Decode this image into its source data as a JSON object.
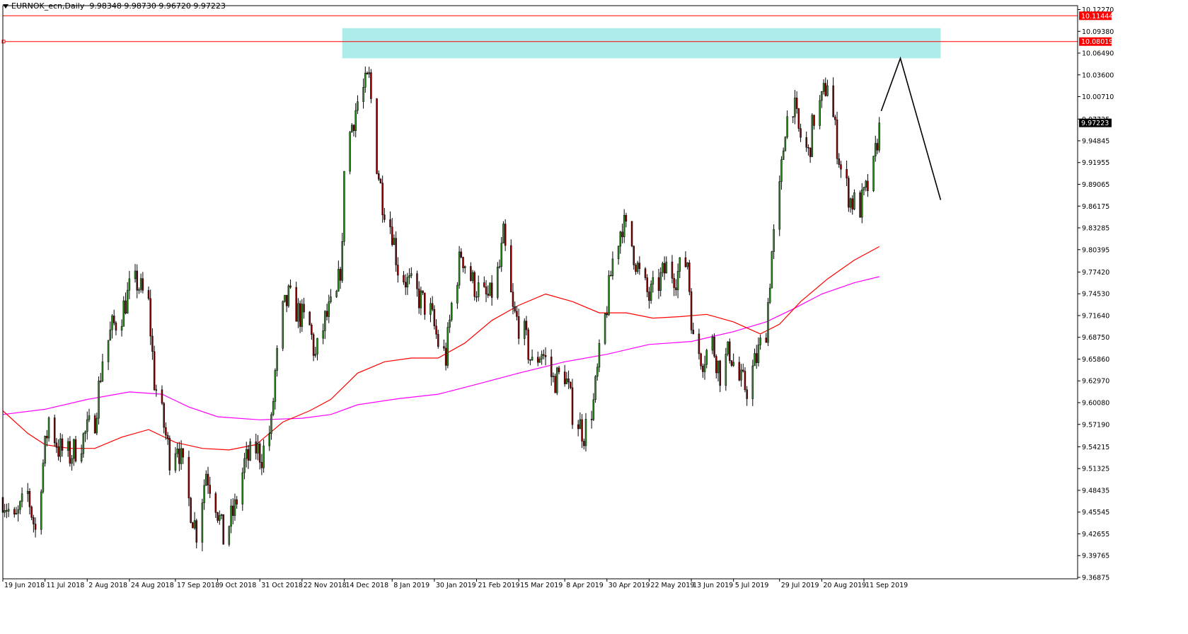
{
  "header": {
    "symbol": "EURNOK_ecn,Daily",
    "ohlc": "9.98348 9.98730 9.96720 9.97223"
  },
  "colors": {
    "bull": "#2e8b22",
    "bear": "#8b0000",
    "ma_fast": "#ff0000",
    "ma_slow": "#ff00ff",
    "zone": "#aeeceb",
    "hline": "#ff0000",
    "projection": "#000000"
  },
  "chart_data": {
    "type": "candlestick",
    "title": "",
    "ylim": [
      9.36875,
      10.1227
    ],
    "y_ticks": [
      {
        "value": 10.1227,
        "label": "10.12270"
      },
      {
        "value": 10.0938,
        "label": "10.09380"
      },
      {
        "value": 10.0649,
        "label": "10.06490"
      },
      {
        "value": 10.036,
        "label": "10.03600"
      },
      {
        "value": 10.0071,
        "label": "10.00710"
      },
      {
        "value": 9.97725,
        "label": "9.97725"
      },
      {
        "value": 9.94845,
        "label": "9.94845"
      },
      {
        "value": 9.91955,
        "label": "9.91955"
      },
      {
        "value": 9.89065,
        "label": "9.89065"
      },
      {
        "value": 9.86175,
        "label": "9.86175"
      },
      {
        "value": 9.83285,
        "label": "9.83285"
      },
      {
        "value": 9.80395,
        "label": "9.80395"
      },
      {
        "value": 9.7742,
        "label": "9.77420"
      },
      {
        "value": 9.7453,
        "label": "9.74530"
      },
      {
        "value": 9.7164,
        "label": "9.71640"
      },
      {
        "value": 9.6875,
        "label": "9.68750"
      },
      {
        "value": 9.6586,
        "label": "9.65860"
      },
      {
        "value": 9.6297,
        "label": "9.62970"
      },
      {
        "value": 9.6008,
        "label": "9.60080"
      },
      {
        "value": 9.5719,
        "label": "9.57190"
      },
      {
        "value": 9.54215,
        "label": "9.54215"
      },
      {
        "value": 9.51325,
        "label": "9.51325"
      },
      {
        "value": 9.48435,
        "label": "9.48435"
      },
      {
        "value": 9.45545,
        "label": "9.45545"
      },
      {
        "value": 9.42655,
        "label": "9.42655"
      },
      {
        "value": 9.39765,
        "label": "9.39765"
      },
      {
        "value": 9.36875,
        "label": "9.36875"
      }
    ],
    "price_tags": [
      {
        "value": 10.11444,
        "label": "10.11444",
        "kind": "line"
      },
      {
        "value": 10.08019,
        "label": "10.08019",
        "kind": "line"
      },
      {
        "value": 9.97223,
        "label": "9.97223",
        "kind": "current"
      }
    ],
    "x_labels": [
      {
        "date": "2018-06-19",
        "label": "19 Jun 2018"
      },
      {
        "date": "2018-07-11",
        "label": "11 Jul 2018"
      },
      {
        "date": "2018-08-02",
        "label": "2 Aug 2018"
      },
      {
        "date": "2018-08-24",
        "label": "24 Aug 2018"
      },
      {
        "date": "2018-09-17",
        "label": "17 Sep 2018"
      },
      {
        "date": "2018-10-09",
        "label": "9 Oct 2018"
      },
      {
        "date": "2018-10-31",
        "label": "31 Oct 2018"
      },
      {
        "date": "2018-11-22",
        "label": "22 Nov 2018"
      },
      {
        "date": "2018-12-14",
        "label": "14 Dec 2018"
      },
      {
        "date": "2019-01-08",
        "label": "8 Jan 2019"
      },
      {
        "date": "2019-01-30",
        "label": "30 Jan 2019"
      },
      {
        "date": "2019-02-21",
        "label": "21 Feb 2019"
      },
      {
        "date": "2019-03-15",
        "label": "15 Mar 2019"
      },
      {
        "date": "2019-04-08",
        "label": "8 Apr 2019"
      },
      {
        "date": "2019-04-30",
        "label": "30 Apr 2019"
      },
      {
        "date": "2019-05-22",
        "label": "22 May 2019"
      },
      {
        "date": "2019-06-13",
        "label": "13 Jun 2019"
      },
      {
        "date": "2019-07-05",
        "label": "5 Jul 2019"
      },
      {
        "date": "2019-07-29",
        "label": "29 Jul 2019"
      },
      {
        "date": "2019-08-20",
        "label": "20 Aug 2019"
      },
      {
        "date": "2019-09-11",
        "label": "11 Sep 2019"
      }
    ],
    "close_path": [
      [
        "2018-06-19",
        9.475
      ],
      [
        "2018-06-25",
        9.44
      ],
      [
        "2018-07-02",
        9.48
      ],
      [
        "2018-07-06",
        9.43
      ],
      [
        "2018-07-09",
        9.5
      ],
      [
        "2018-07-13",
        9.58
      ],
      [
        "2018-07-18",
        9.54
      ],
      [
        "2018-07-24",
        9.53
      ],
      [
        "2018-07-30",
        9.55
      ],
      [
        "2018-08-06",
        9.58
      ],
      [
        "2018-08-10",
        9.66
      ],
      [
        "2018-08-15",
        9.7
      ],
      [
        "2018-08-20",
        9.72
      ],
      [
        "2018-08-24",
        9.75
      ],
      [
        "2018-08-28",
        9.76
      ],
      [
        "2018-09-03",
        9.73
      ],
      [
        "2018-09-06",
        9.63
      ],
      [
        "2018-09-11",
        9.57
      ],
      [
        "2018-09-14",
        9.53
      ],
      [
        "2018-09-18",
        9.55
      ],
      [
        "2018-09-24",
        9.47
      ],
      [
        "2018-09-28",
        9.43
      ],
      [
        "2018-10-03",
        9.51
      ],
      [
        "2018-10-08",
        9.47
      ],
      [
        "2018-10-12",
        9.42
      ],
      [
        "2018-10-18",
        9.46
      ],
      [
        "2018-10-23",
        9.52
      ],
      [
        "2018-10-29",
        9.54
      ],
      [
        "2018-11-01",
        9.53
      ],
      [
        "2018-11-06",
        9.57
      ],
      [
        "2018-11-08",
        9.64
      ],
      [
        "2018-11-12",
        9.72
      ],
      [
        "2018-11-15",
        9.74
      ],
      [
        "2018-11-20",
        9.72
      ],
      [
        "2018-11-26",
        9.7
      ],
      [
        "2018-11-29",
        9.66
      ],
      [
        "2018-12-04",
        9.71
      ],
      [
        "2018-12-10",
        9.74
      ],
      [
        "2018-12-13",
        9.8
      ],
      [
        "2018-12-14",
        9.92
      ],
      [
        "2018-12-18",
        9.97
      ],
      [
        "2018-12-21",
        10.0
      ],
      [
        "2018-12-27",
        10.03
      ],
      [
        "2018-12-31",
        9.92
      ],
      [
        "2019-01-03",
        9.87
      ],
      [
        "2019-01-08",
        9.83
      ],
      [
        "2019-01-11",
        9.78
      ],
      [
        "2019-01-16",
        9.76
      ],
      [
        "2019-01-22",
        9.74
      ],
      [
        "2019-01-28",
        9.72
      ],
      [
        "2019-02-01",
        9.68
      ],
      [
        "2019-02-05",
        9.66
      ],
      [
        "2019-02-08",
        9.73
      ],
      [
        "2019-02-13",
        9.8
      ],
      [
        "2019-02-19",
        9.76
      ],
      [
        "2019-02-25",
        9.74
      ],
      [
        "2019-02-28",
        9.74
      ],
      [
        "2019-03-05",
        9.78
      ],
      [
        "2019-03-07",
        9.82
      ],
      [
        "2019-03-12",
        9.72
      ],
      [
        "2019-03-18",
        9.69
      ],
      [
        "2019-03-22",
        9.65
      ],
      [
        "2019-03-27",
        9.67
      ],
      [
        "2019-04-02",
        9.63
      ],
      [
        "2019-04-08",
        9.64
      ],
      [
        "2019-04-12",
        9.59
      ],
      [
        "2019-04-18",
        9.56
      ],
      [
        "2019-04-23",
        9.6
      ],
      [
        "2019-04-26",
        9.66
      ],
      [
        "2019-04-30",
        9.73
      ],
      [
        "2019-05-03",
        9.79
      ],
      [
        "2019-05-08",
        9.84
      ],
      [
        "2019-05-13",
        9.81
      ],
      [
        "2019-05-17",
        9.77
      ],
      [
        "2019-05-22",
        9.74
      ],
      [
        "2019-05-27",
        9.76
      ],
      [
        "2019-05-31",
        9.78
      ],
      [
        "2019-06-05",
        9.77
      ],
      [
        "2019-06-11",
        9.79
      ],
      [
        "2019-06-14",
        9.68
      ],
      [
        "2019-06-19",
        9.66
      ],
      [
        "2019-06-24",
        9.68
      ],
      [
        "2019-06-28",
        9.64
      ],
      [
        "2019-07-03",
        9.67
      ],
      [
        "2019-07-08",
        9.63
      ],
      [
        "2019-07-12",
        9.62
      ],
      [
        "2019-07-17",
        9.66
      ],
      [
        "2019-07-22",
        9.7
      ],
      [
        "2019-07-25",
        9.8
      ],
      [
        "2019-07-29",
        9.88
      ],
      [
        "2019-08-01",
        9.97
      ],
      [
        "2019-08-05",
        10.0
      ],
      [
        "2019-08-08",
        9.96
      ],
      [
        "2019-08-13",
        9.93
      ],
      [
        "2019-08-16",
        9.98
      ],
      [
        "2019-08-20",
        10.0
      ],
      [
        "2019-08-23",
        10.03
      ],
      [
        "2019-08-27",
        9.96
      ],
      [
        "2019-08-30",
        9.91
      ],
      [
        "2019-09-04",
        9.87
      ],
      [
        "2019-09-09",
        9.86
      ],
      [
        "2019-09-12",
        9.88
      ],
      [
        "2019-09-16",
        9.91
      ],
      [
        "2019-09-19",
        9.97223
      ]
    ],
    "ma_fast": [
      [
        "2018-06-19",
        9.59
      ],
      [
        "2018-07-02",
        9.56
      ],
      [
        "2018-07-11",
        9.545
      ],
      [
        "2018-07-24",
        9.54
      ],
      [
        "2018-08-06",
        9.54
      ],
      [
        "2018-08-20",
        9.555
      ],
      [
        "2018-09-03",
        9.565
      ],
      [
        "2018-09-17",
        9.548
      ],
      [
        "2018-10-01",
        9.54
      ],
      [
        "2018-10-15",
        9.538
      ],
      [
        "2018-10-29",
        9.545
      ],
      [
        "2018-11-12",
        9.575
      ],
      [
        "2018-11-26",
        9.59
      ],
      [
        "2018-12-07",
        9.605
      ],
      [
        "2018-12-21",
        9.64
      ],
      [
        "2019-01-04",
        9.655
      ],
      [
        "2019-01-18",
        9.66
      ],
      [
        "2019-02-01",
        9.66
      ],
      [
        "2019-02-15",
        9.68
      ],
      [
        "2019-03-01",
        9.71
      ],
      [
        "2019-03-15",
        9.73
      ],
      [
        "2019-03-29",
        9.745
      ],
      [
        "2019-04-12",
        9.735
      ],
      [
        "2019-04-26",
        9.72
      ],
      [
        "2019-05-10",
        9.72
      ],
      [
        "2019-05-24",
        9.713
      ],
      [
        "2019-06-07",
        9.715
      ],
      [
        "2019-06-21",
        9.718
      ],
      [
        "2019-07-05",
        9.708
      ],
      [
        "2019-07-19",
        9.692
      ],
      [
        "2019-07-29",
        9.705
      ],
      [
        "2019-08-09",
        9.735
      ],
      [
        "2019-08-23",
        9.765
      ],
      [
        "2019-09-06",
        9.79
      ],
      [
        "2019-09-19",
        9.808
      ]
    ],
    "ma_slow": [
      [
        "2018-06-19",
        9.585
      ],
      [
        "2018-07-11",
        9.592
      ],
      [
        "2018-08-02",
        9.605
      ],
      [
        "2018-08-24",
        9.615
      ],
      [
        "2018-09-10",
        9.612
      ],
      [
        "2018-09-24",
        9.595
      ],
      [
        "2018-10-09",
        9.582
      ],
      [
        "2018-10-31",
        9.578
      ],
      [
        "2018-11-22",
        9.58
      ],
      [
        "2018-12-07",
        9.585
      ],
      [
        "2018-12-21",
        9.598
      ],
      [
        "2019-01-11",
        9.606
      ],
      [
        "2019-02-01",
        9.612
      ],
      [
        "2019-02-21",
        9.625
      ],
      [
        "2019-03-15",
        9.64
      ],
      [
        "2019-04-08",
        9.655
      ],
      [
        "2019-04-30",
        9.665
      ],
      [
        "2019-05-22",
        9.678
      ],
      [
        "2019-06-13",
        9.682
      ],
      [
        "2019-07-05",
        9.695
      ],
      [
        "2019-07-22",
        9.708
      ],
      [
        "2019-08-05",
        9.725
      ],
      [
        "2019-08-20",
        9.745
      ],
      [
        "2019-09-06",
        9.76
      ],
      [
        "2019-09-19",
        9.768
      ]
    ],
    "zone": {
      "date_from": "2018-12-13",
      "date_to": "2019-10-21",
      "y_from": 10.058,
      "y_to": 10.098
    },
    "hlines": [
      10.11444,
      10.08019
    ],
    "projection": [
      [
        "2019-09-20",
        9.988
      ],
      [
        "2019-09-30",
        10.058
      ],
      [
        "2019-10-21",
        9.87
      ]
    ]
  }
}
